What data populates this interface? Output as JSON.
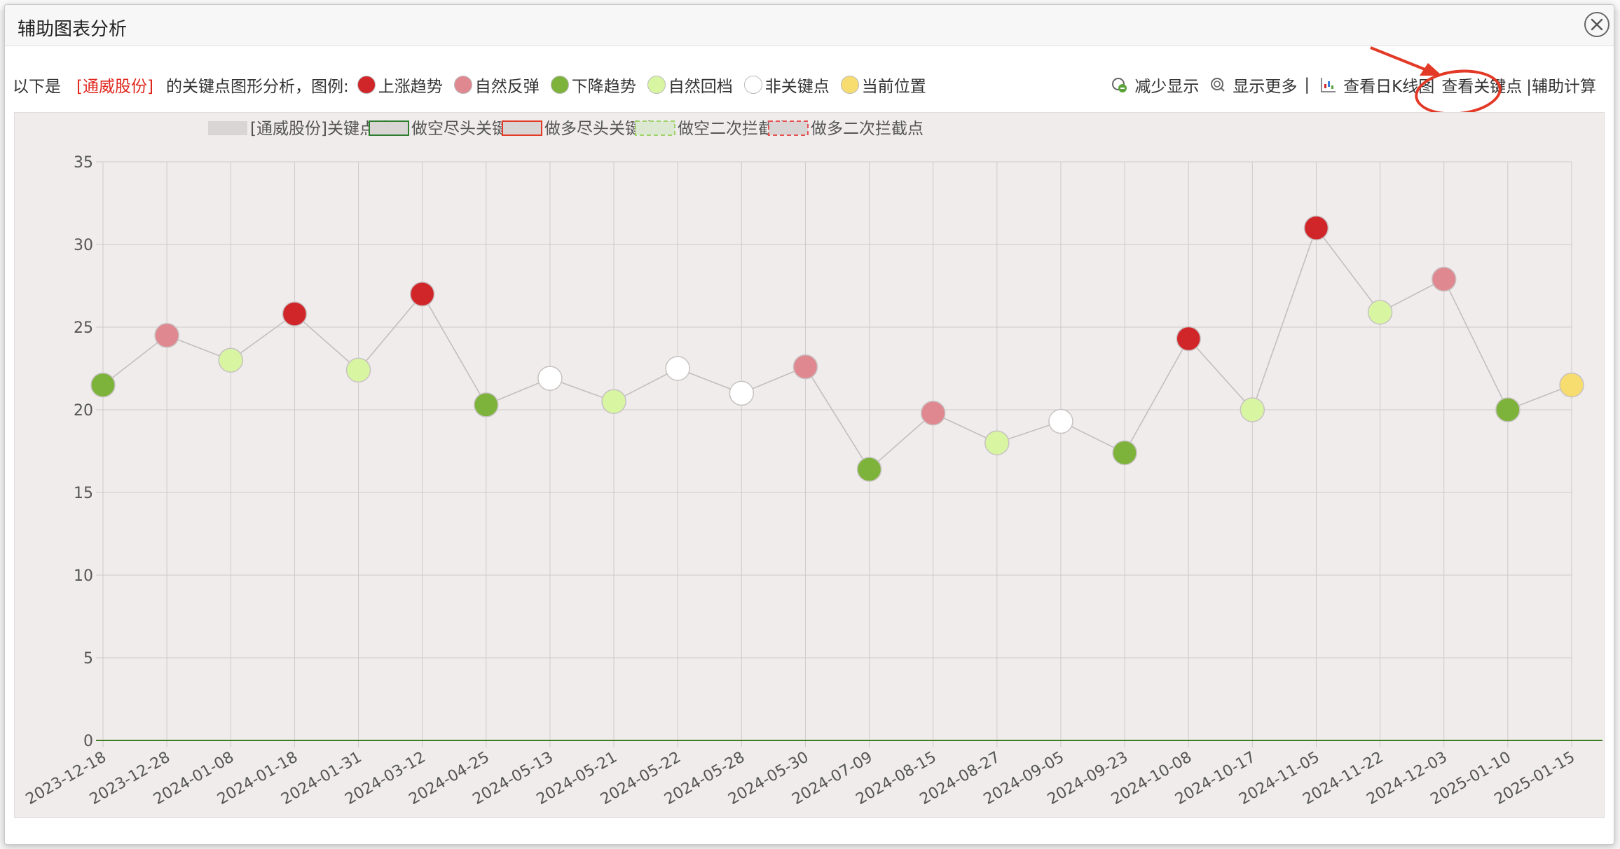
{
  "window": {
    "title": "辅助图表分析",
    "close_icon": "close-circle-icon"
  },
  "toolbar": {
    "intro_prefix": "以下是",
    "stock_name": "[通威股份]",
    "intro_suffix": "的关键点图形分析，图例:",
    "legend": [
      {
        "label": "上涨趋势",
        "color": "#d0262a"
      },
      {
        "label": "自然反弹",
        "color": "#e08890"
      },
      {
        "label": "下降趋势",
        "color": "#7db33a"
      },
      {
        "label": "自然回档",
        "color": "#d8f5a2"
      },
      {
        "label": "非关键点",
        "color": "#ffffff"
      },
      {
        "label": "当前位置",
        "color": "#f7dc6f"
      }
    ]
  },
  "actions": {
    "show_less": "减少显示",
    "show_more": "显示更多",
    "separator": "|",
    "daily_k": "查看日K线图",
    "key_points": "查看关键点",
    "aux_calc": "|辅助计算"
  },
  "chart_data": {
    "type": "line",
    "legend": [
      {
        "label": "[通威股份]关键点清单",
        "style": "solid-gray"
      },
      {
        "label": "做空尽头关键点",
        "style": "green-border"
      },
      {
        "label": "做多尽头关键点",
        "style": "red-border"
      },
      {
        "label": "做空二次拦截点",
        "style": "green-dashed"
      },
      {
        "label": "做多二次拦截点",
        "style": "red-dashed"
      }
    ],
    "ylim": [
      0,
      35
    ],
    "yticks": [
      0,
      5,
      10,
      15,
      20,
      25,
      30,
      35
    ],
    "categories": [
      "2023-12-18",
      "2023-12-28",
      "2024-01-08",
      "2024-01-18",
      "2024-01-31",
      "2024-03-12",
      "2024-04-25",
      "2024-05-13",
      "2024-05-21",
      "2024-05-22",
      "2024-05-28",
      "2024-05-30",
      "2024-07-09",
      "2024-08-15",
      "2024-08-27",
      "2024-09-05",
      "2024-09-23",
      "2024-10-08",
      "2024-10-17",
      "2024-11-05",
      "2024-11-22",
      "2024-12-03",
      "2025-01-10",
      "2025-01-15"
    ],
    "values": [
      21.5,
      24.5,
      23.0,
      25.8,
      22.4,
      27.0,
      20.3,
      21.9,
      20.5,
      22.5,
      21.0,
      22.6,
      16.4,
      19.8,
      18.0,
      19.3,
      17.4,
      24.3,
      20.0,
      31.0,
      25.9,
      27.9,
      20.0,
      21.5
    ],
    "point_types": [
      "down",
      "rebound",
      "pullback",
      "up",
      "pullback",
      "up",
      "down",
      "none",
      "pullback",
      "none",
      "none",
      "rebound",
      "down",
      "rebound",
      "pullback",
      "none",
      "down",
      "up",
      "pullback",
      "up",
      "pullback",
      "rebound",
      "down",
      "current"
    ],
    "type_colors": {
      "up": "#d0262a",
      "rebound": "#e08890",
      "down": "#7db33a",
      "pullback": "#d8f5a2",
      "none": "#ffffff",
      "current": "#f7dc6f"
    },
    "grid": true
  }
}
